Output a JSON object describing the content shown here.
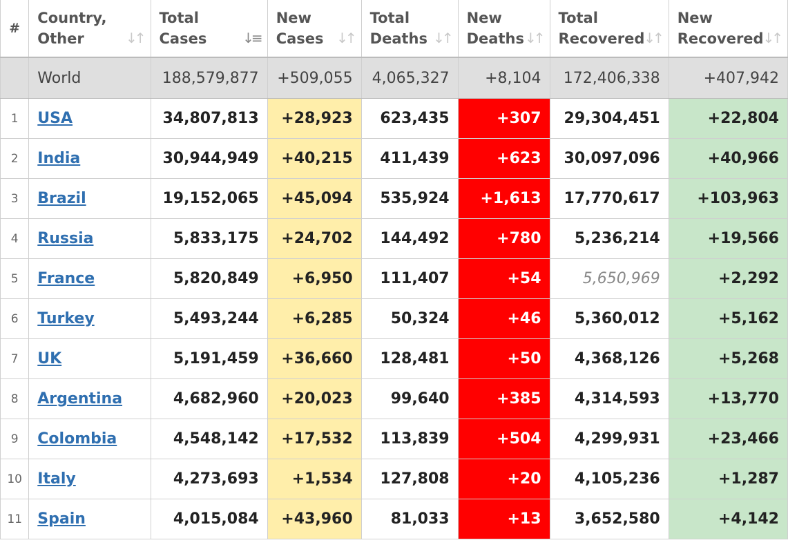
{
  "colors": {
    "new_cases_bg": "#ffeeaa",
    "new_deaths_bg": "#ff0000",
    "new_recovered_bg": "#c8e6c9",
    "link": "#2f6fb0",
    "world_bg": "#dfdfdf"
  },
  "headers": [
    {
      "line1": "#",
      "line2": ""
    },
    {
      "line1": "Country,",
      "line2": "Other"
    },
    {
      "line1": "Total",
      "line2": "Cases"
    },
    {
      "line1": "New",
      "line2": "Cases"
    },
    {
      "line1": "Total",
      "line2": "Deaths"
    },
    {
      "line1": "New",
      "line2": "Deaths"
    },
    {
      "line1": "Total",
      "line2": "Recovered"
    },
    {
      "line1": "New",
      "line2": "Recovered"
    }
  ],
  "sort_icons": {
    "default": "sort-icon",
    "active": "sort-descending-icon",
    "active_column": "Total Cases"
  },
  "world": {
    "name": "World",
    "total_cases": "188,579,877",
    "new_cases": "+509,055",
    "total_deaths": "4,065,327",
    "new_deaths": "+8,104",
    "total_recovered": "172,406,338",
    "new_recovered": "+407,942"
  },
  "rows": [
    {
      "rank": "1",
      "country": "USA",
      "total_cases": "34,807,813",
      "new_cases": "+28,923",
      "total_deaths": "623,435",
      "new_deaths": "+307",
      "total_recovered": "29,304,451",
      "new_recovered": "+22,804"
    },
    {
      "rank": "2",
      "country": "India",
      "total_cases": "30,944,949",
      "new_cases": "+40,215",
      "total_deaths": "411,439",
      "new_deaths": "+623",
      "total_recovered": "30,097,096",
      "new_recovered": "+40,966"
    },
    {
      "rank": "3",
      "country": "Brazil",
      "total_cases": "19,152,065",
      "new_cases": "+45,094",
      "total_deaths": "535,924",
      "new_deaths": "+1,613",
      "total_recovered": "17,770,617",
      "new_recovered": "+103,963"
    },
    {
      "rank": "4",
      "country": "Russia",
      "total_cases": "5,833,175",
      "new_cases": "+24,702",
      "total_deaths": "144,492",
      "new_deaths": "+780",
      "total_recovered": "5,236,214",
      "new_recovered": "+19,566"
    },
    {
      "rank": "5",
      "country": "France",
      "total_cases": "5,820,849",
      "new_cases": "+6,950",
      "total_deaths": "111,407",
      "new_deaths": "+54",
      "total_recovered": "5,650,969",
      "recovered_estimated": true,
      "new_recovered": "+2,292"
    },
    {
      "rank": "6",
      "country": "Turkey",
      "total_cases": "5,493,244",
      "new_cases": "+6,285",
      "total_deaths": "50,324",
      "new_deaths": "+46",
      "total_recovered": "5,360,012",
      "new_recovered": "+5,162"
    },
    {
      "rank": "7",
      "country": "UK",
      "total_cases": "5,191,459",
      "new_cases": "+36,660",
      "total_deaths": "128,481",
      "new_deaths": "+50",
      "total_recovered": "4,368,126",
      "new_recovered": "+5,268"
    },
    {
      "rank": "8",
      "country": "Argentina",
      "total_cases": "4,682,960",
      "new_cases": "+20,023",
      "total_deaths": "99,640",
      "new_deaths": "+385",
      "total_recovered": "4,314,593",
      "new_recovered": "+13,770"
    },
    {
      "rank": "9",
      "country": "Colombia",
      "total_cases": "4,548,142",
      "new_cases": "+17,532",
      "total_deaths": "113,839",
      "new_deaths": "+504",
      "total_recovered": "4,299,931",
      "new_recovered": "+23,466"
    },
    {
      "rank": "10",
      "country": "Italy",
      "total_cases": "4,273,693",
      "new_cases": "+1,534",
      "total_deaths": "127,808",
      "new_deaths": "+20",
      "total_recovered": "4,105,236",
      "new_recovered": "+1,287"
    },
    {
      "rank": "11",
      "country": "Spain",
      "total_cases": "4,015,084",
      "new_cases": "+43,960",
      "total_deaths": "81,033",
      "new_deaths": "+13",
      "total_recovered": "3,652,580",
      "new_recovered": "+4,142"
    }
  ]
}
